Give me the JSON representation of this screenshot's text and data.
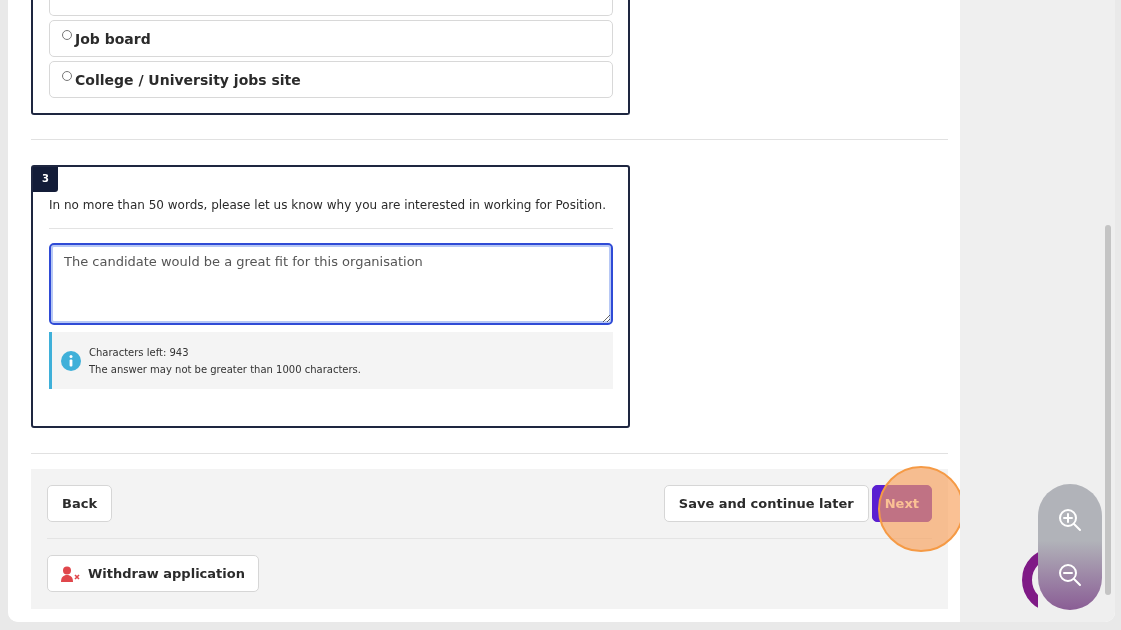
{
  "question_2": {
    "options": [
      {
        "label": "Job board",
        "selected": false
      },
      {
        "label": "College / University jobs site",
        "selected": false
      }
    ]
  },
  "question_3": {
    "number": "3",
    "prompt": "In no more than 50 words, please let us know why you are interested in working for Position.",
    "answer": "The candidate would be a great fit for this organisation",
    "info": {
      "counter": "Characters left: 943",
      "limit": "The answer may not be greater than 1000 characters."
    }
  },
  "footer": {
    "back": "Back",
    "save": "Save and continue later",
    "next": "Next",
    "withdraw": "Withdraw application"
  },
  "click_highlight": true
}
